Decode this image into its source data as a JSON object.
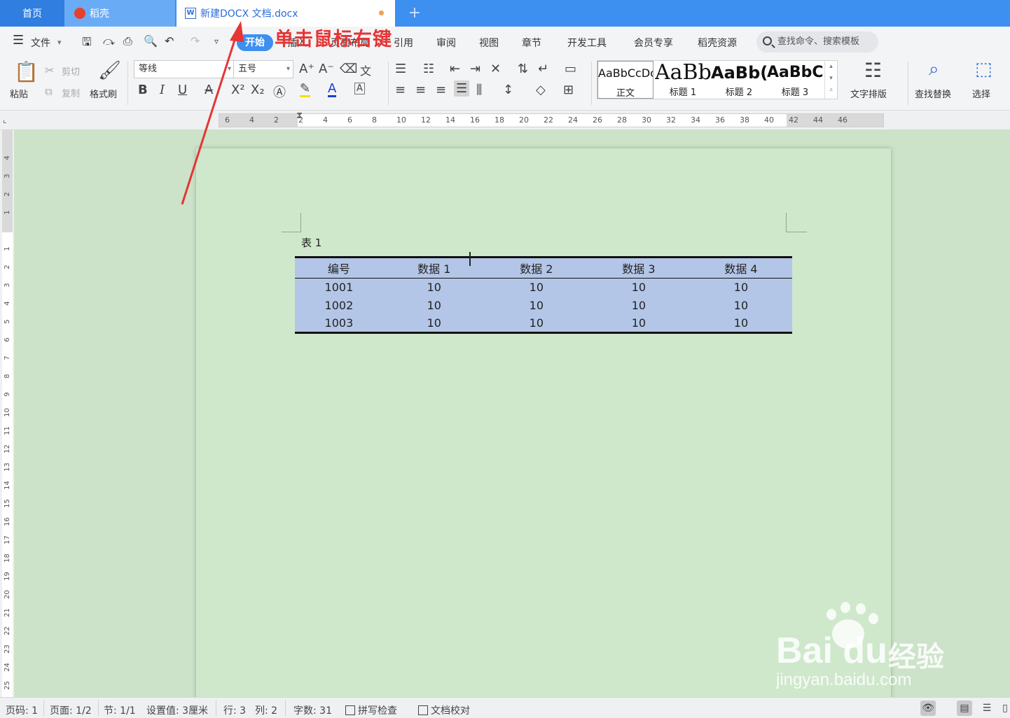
{
  "tabs": {
    "home": "首页",
    "daoke": "稻壳",
    "document": "新建DOCX 文档.docx",
    "add": "+"
  },
  "menu": {
    "file": "文件",
    "start": "开始",
    "insert": "插入",
    "layout": "页面布局",
    "reference": "引用",
    "review": "审阅",
    "view": "视图",
    "chapter": "章节",
    "developer": "开发工具",
    "member": "会员专享",
    "daoke_res": "稻壳资源",
    "search_placeholder": "查找命令、搜索模板"
  },
  "ribbon": {
    "paste": "粘贴",
    "cut": "剪切",
    "copy": "复制",
    "format_painter": "格式刷",
    "font_name": "等线",
    "font_size": "五号",
    "styles": [
      {
        "sample": "AaBbCcDc",
        "name": "正文"
      },
      {
        "sample": "AaBb",
        "name": "标题 1"
      },
      {
        "sample": "AaBb(",
        "name": "标题 2"
      },
      {
        "sample": "AaBbC",
        "name": "标题 3"
      }
    ],
    "text_layout": "文字排版",
    "find_replace": "查找替换",
    "select": "选择"
  },
  "ruler": {
    "h_numbers": [
      "6",
      "4",
      "2",
      "2",
      "4",
      "6",
      "8",
      "10",
      "12",
      "14",
      "16",
      "18",
      "20",
      "22",
      "24",
      "26",
      "28",
      "30",
      "32",
      "34",
      "36",
      "38",
      "40",
      "42",
      "44",
      "46"
    ],
    "v_top_numbers": [
      "4",
      "3",
      "2",
      "1"
    ],
    "v_numbers": [
      "1",
      "2",
      "3",
      "4",
      "5",
      "6",
      "7",
      "8",
      "9",
      "10",
      "11",
      "12",
      "13",
      "14",
      "15",
      "16",
      "17",
      "18",
      "19",
      "20",
      "21",
      "22",
      "23",
      "24",
      "25"
    ]
  },
  "document": {
    "caption": "表 1",
    "table": {
      "headers": [
        "编号",
        "数据 1",
        "数据 2",
        "数据 3",
        "数据 4"
      ],
      "rows": [
        [
          "1001",
          "10",
          "10",
          "10",
          "10"
        ],
        [
          "1002",
          "10",
          "10",
          "10",
          "10"
        ],
        [
          "1003",
          "10",
          "10",
          "10",
          "10"
        ]
      ]
    }
  },
  "annotation": {
    "text": "单击鼠标右键",
    "color": "#e53535"
  },
  "watermark": {
    "brand": "Bai du",
    "cn": "经验",
    "url": "jingyan.baidu.com"
  },
  "status": {
    "page_code": "页码: 1",
    "pages": "页面: 1/2",
    "section": "节: 1/1",
    "setting": "设置值: 3厘米",
    "row": "行: 3",
    "col": "列: 2",
    "words": "字数: 31",
    "spell_check": "拼写检查",
    "doc_proof": "文档校对"
  },
  "colors": {
    "accent": "#3d8ff0",
    "table_fill": "#b4c6e7",
    "page_bg": "#cfe8cc"
  }
}
